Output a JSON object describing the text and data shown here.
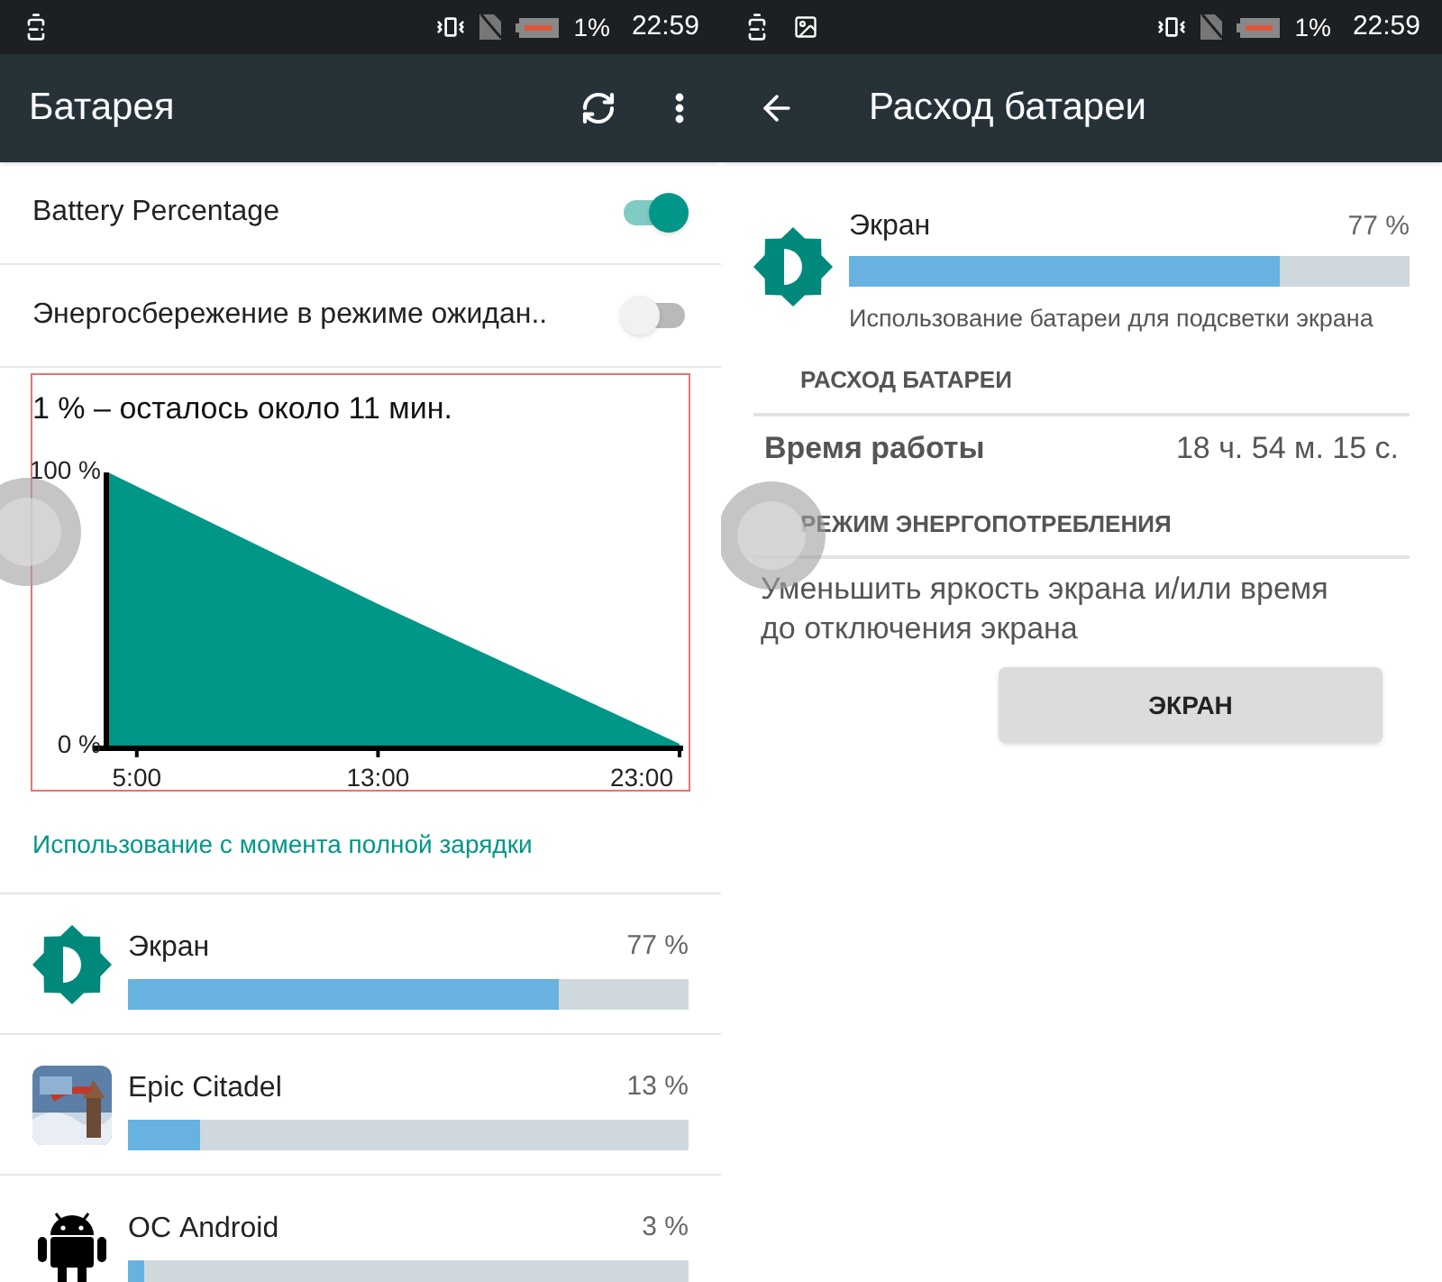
{
  "screens": [
    {
      "status_bar": {
        "notifications": [
          {
            "kind": "alert"
          }
        ],
        "battery": "1%",
        "time": "22:59"
      },
      "app_bar": {
        "title": "Батарея",
        "actions": [
          {
            "kind": "refresh"
          },
          {
            "kind": "more"
          }
        ]
      },
      "settings": [
        {
          "label": "Battery Percentage",
          "on": true
        },
        {
          "label": "Энергосбережение в режиме ожидан..",
          "on": false
        }
      ],
      "estimate": "1 % – осталось около 11 мин.",
      "chart_data": {
        "type": "area",
        "x": [
          4.05,
          13,
          23
        ],
        "series": [
          {
            "color": "#009688",
            "values": [
              100,
              52,
              1
            ]
          }
        ],
        "xlim": [
          4.05,
          23
        ],
        "ylim": [
          0,
          100
        ],
        "xticks": [
          {
            "value": 5,
            "label": "5:00"
          },
          {
            "value": 13,
            "label": "13:00"
          },
          {
            "value": 23,
            "label": "23:00"
          }
        ],
        "yticks": [
          {
            "value": 0,
            "label": "0 %"
          },
          {
            "value": 100,
            "label": "100 %"
          }
        ]
      },
      "link": "Использование с момента полной зарядки",
      "usage": [
        {
          "kind": "screen",
          "name": "Экран",
          "percent": "77 %",
          "level": 0.77
        },
        {
          "kind": "app",
          "name": "Epic Citadel",
          "percent": "13 %",
          "level": 0.13
        },
        {
          "kind": "android",
          "name": "ОС Android",
          "percent": "3 %",
          "level": 0.03
        }
      ]
    },
    {
      "status_bar": {
        "notifications": [
          {
            "kind": "alert"
          },
          {
            "kind": "image"
          }
        ],
        "battery": "1%",
        "time": "22:59"
      },
      "app_bar": {
        "title": "Расход батареи",
        "nav": {
          "kind": "back"
        }
      },
      "detail": {
        "kind": "screen",
        "name": "Экран",
        "percent": "77 %",
        "level": 0.77,
        "description": "Использование батареи для подсветки экрана"
      },
      "sections": [
        {
          "header": "РАСХОД БАТАРЕИ",
          "rows": [
            {
              "label": "Время работы",
              "value": "18 ч. 54 м. 15 с."
            }
          ]
        },
        {
          "header": "РЕЖИМ ЭНЕРГОПОТРЕБЛЕНИЯ",
          "text": "Уменьшить яркость экрана и/или время до отключения экрана",
          "button": "ЭКРАН"
        }
      ]
    }
  ]
}
